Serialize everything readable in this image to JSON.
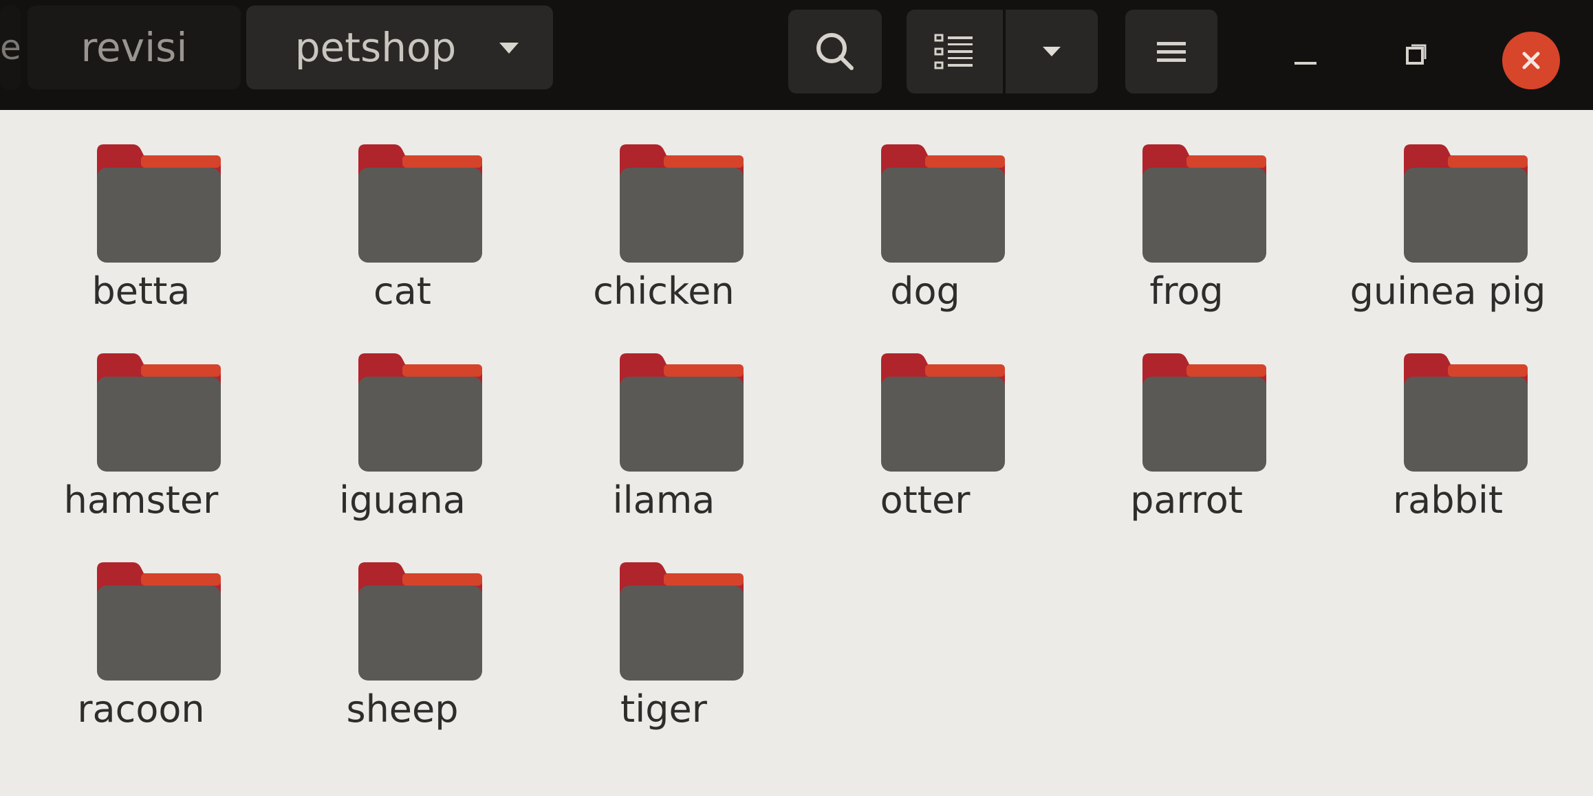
{
  "breadcrumb": {
    "previous_fragment": "e",
    "items": [
      "revisi",
      "petshop"
    ]
  },
  "toolbar": {
    "search_icon": "search-icon",
    "view_icon": "list-view-icon",
    "view_dropdown_icon": "chevron-down-icon",
    "menu_icon": "hamburger-menu-icon"
  },
  "window_controls": {
    "minimize_icon": "minimize-icon",
    "maximize_icon": "maximize-icon",
    "close_icon": "close-icon",
    "close_color": "#d7452a"
  },
  "colors": {
    "folder_body": "#5b5956",
    "folder_tab": "#b0242c",
    "folder_accent": "#d5432b",
    "header_bg": "#121110",
    "content_bg": "#ecebe7"
  },
  "folders": [
    {
      "name": "betta"
    },
    {
      "name": "cat"
    },
    {
      "name": "chicken"
    },
    {
      "name": "dog"
    },
    {
      "name": "frog"
    },
    {
      "name": "guinea pig"
    },
    {
      "name": "hamster"
    },
    {
      "name": "iguana"
    },
    {
      "name": "ilama"
    },
    {
      "name": "otter"
    },
    {
      "name": "parrot"
    },
    {
      "name": "rabbit"
    },
    {
      "name": "racoon"
    },
    {
      "name": "sheep"
    },
    {
      "name": "tiger"
    }
  ]
}
